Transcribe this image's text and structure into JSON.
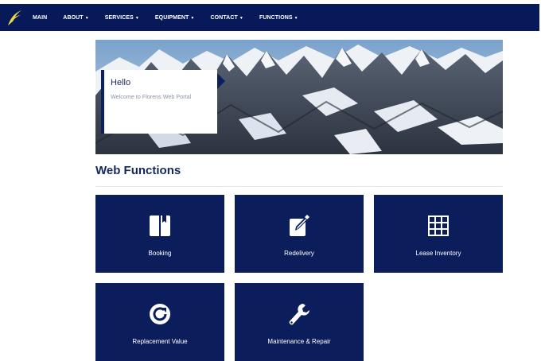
{
  "nav": {
    "items": [
      {
        "label": "MAIN",
        "has_caret": false
      },
      {
        "label": "ABOUT",
        "has_caret": true
      },
      {
        "label": "SERVICES",
        "has_caret": true
      },
      {
        "label": "EQUIPMENT",
        "has_caret": true
      },
      {
        "label": "CONTACT",
        "has_caret": true
      },
      {
        "label": "FUNCTIONS",
        "has_caret": true
      }
    ],
    "caret_glyph": "▼",
    "background": "#08195a",
    "logo_color": "#e8d84a"
  },
  "hero": {
    "greeting_title": "Hello",
    "greeting_subtitle": "Welcome to Florens Web Portal"
  },
  "section": {
    "title": "Web Functions"
  },
  "tiles": [
    {
      "label": "Booking",
      "icon": "book-icon"
    },
    {
      "label": "Redelivery",
      "icon": "edit-icon"
    },
    {
      "label": "Lease Inventory",
      "icon": "grid-icon"
    },
    {
      "label": "Replacement Value",
      "icon": "refresh-icon"
    },
    {
      "label": "Maintenance & Repair",
      "icon": "wrench-icon"
    }
  ],
  "colors": {
    "tile_bg": "#0b1e5b",
    "accent": "#0c1f5e"
  }
}
